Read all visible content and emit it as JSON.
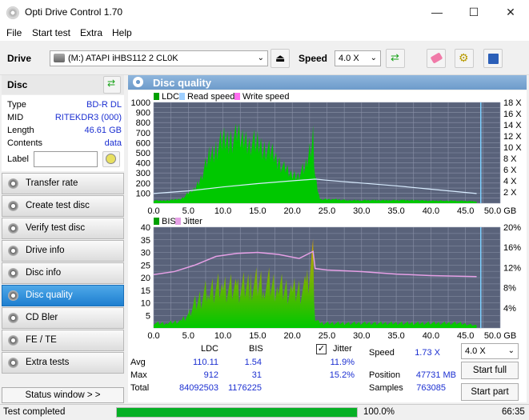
{
  "window": {
    "title": "Opti Drive Control 1.70",
    "minimize": "—",
    "maximize": "☐",
    "close": "✕"
  },
  "menu": [
    "File",
    "Start test",
    "Extra",
    "Help"
  ],
  "toolbar": {
    "drive_label": "Drive",
    "drive_value": "(M:)  ATAPI iHBS112  2 CL0K",
    "speed_label": "Speed",
    "speed_value": "4.0 X"
  },
  "disc": {
    "header": "Disc",
    "rows": [
      {
        "key": "Type",
        "value": "BD-R DL"
      },
      {
        "key": "MID",
        "value": "RITEKDR3 (000)"
      },
      {
        "key": "Length",
        "value": "46.61 GB"
      },
      {
        "key": "Contents",
        "value": "data"
      }
    ],
    "label_key": "Label",
    "label_value": ""
  },
  "nav": [
    {
      "label": "Transfer rate",
      "active": false
    },
    {
      "label": "Create test disc",
      "active": false
    },
    {
      "label": "Verify test disc",
      "active": false
    },
    {
      "label": "Drive info",
      "active": false
    },
    {
      "label": "Disc info",
      "active": false
    },
    {
      "label": "Disc quality",
      "active": true
    },
    {
      "label": "CD Bler",
      "active": false
    },
    {
      "label": "FE / TE",
      "active": false
    },
    {
      "label": "Extra tests",
      "active": false
    }
  ],
  "status_window_button": "Status window > >",
  "panel_title": "Disc quality",
  "chart_data": [
    {
      "type": "area",
      "legend": [
        "LDC",
        "Read speed",
        "Write speed"
      ],
      "colors": {
        "LDC": "#00c800",
        "Read speed": "#9ecfff",
        "Write speed": "#ff6ef0"
      },
      "x_ticks": [
        "0.0",
        "5.0",
        "10.0",
        "15.0",
        "20.0",
        "25.0",
        "30.0",
        "35.0",
        "40.0",
        "45.0",
        "50.0 GB"
      ],
      "y_ticks_left": [
        "100",
        "200",
        "300",
        "400",
        "500",
        "600",
        "700",
        "800",
        "900",
        "1000"
      ],
      "y_ticks_right": [
        "2 X",
        "4 X",
        "6 X",
        "8 X",
        "10 X",
        "12 X",
        "14 X",
        "16 X",
        "18 X"
      ],
      "xlim": [
        0,
        50
      ],
      "ylim": [
        0,
        1000
      ],
      "y2lim": [
        0,
        18
      ],
      "ldc_x": [
        0,
        1,
        2,
        3,
        4,
        5,
        6,
        7,
        8,
        9,
        10,
        11,
        12,
        13,
        14,
        15,
        16,
        17,
        18,
        19,
        20,
        21,
        22,
        23,
        23.3,
        24,
        26,
        28,
        30,
        32,
        34,
        36,
        38,
        40,
        42,
        44,
        46,
        46.6
      ],
      "ldc": [
        30,
        25,
        30,
        35,
        45,
        100,
        150,
        300,
        480,
        560,
        640,
        650,
        680,
        660,
        630,
        610,
        560,
        520,
        430,
        340,
        290,
        300,
        380,
        700,
        260,
        40,
        40,
        30,
        30,
        30,
        30,
        30,
        30,
        25,
        25,
        25,
        20,
        15
      ],
      "read_speed_x": [
        0,
        5,
        10,
        15,
        20,
        23.3,
        25,
        30,
        35,
        40,
        46.6
      ],
      "read_speed": [
        1.73,
        2.2,
        2.9,
        3.5,
        4.0,
        4.3,
        4.1,
        3.6,
        3.1,
        2.5,
        1.73
      ]
    },
    {
      "type": "area",
      "legend": [
        "BIS",
        "Jitter"
      ],
      "colors": {
        "BIS": "#00c800",
        "Jitter": "#e6a0e6"
      },
      "x_ticks": [
        "0.0",
        "5.0",
        "10.0",
        "15.0",
        "20.0",
        "25.0",
        "30.0",
        "35.0",
        "40.0",
        "45.0",
        "50.0 GB"
      ],
      "y_ticks_left": [
        "5",
        "10",
        "15",
        "20",
        "25",
        "30",
        "35",
        "40"
      ],
      "y_ticks_right": [
        "4%",
        "8%",
        "12%",
        "16%",
        "20%"
      ],
      "xlim": [
        0,
        50
      ],
      "ylim": [
        0,
        40
      ],
      "y2lim": [
        0,
        20
      ],
      "bis_x": [
        0,
        2,
        4,
        5,
        6,
        8,
        10,
        12,
        14,
        16,
        18,
        20,
        22,
        23,
        23.3,
        24,
        28,
        32,
        36,
        40,
        44,
        46.6
      ],
      "bis": [
        2,
        2,
        3,
        5,
        10,
        16,
        17,
        16,
        18,
        19,
        17,
        15,
        16,
        27,
        4,
        2,
        2,
        2,
        2,
        2,
        2,
        1
      ],
      "jitter_x": [
        0,
        3,
        6,
        9,
        12,
        15,
        18,
        21,
        23,
        23.3,
        25,
        30,
        35,
        40,
        46.6
      ],
      "jitter": [
        10.6,
        11.2,
        12.5,
        14.2,
        14.8,
        15.0,
        14.6,
        13.8,
        15.2,
        11.8,
        11.5,
        11.2,
        10.7,
        10.4,
        10.2
      ]
    }
  ],
  "stats": {
    "col_ldc": "LDC",
    "col_bis": "BIS",
    "jitter_label": "Jitter",
    "jitter_checked": true,
    "rows": [
      {
        "label": "Avg",
        "ldc": "110.11",
        "bis": "1.54",
        "jitter": "11.9%"
      },
      {
        "label": "Max",
        "ldc": "912",
        "bis": "31",
        "jitter": "15.2%"
      },
      {
        "label": "Total",
        "ldc": "84092503",
        "bis": "1176225",
        "jitter": ""
      }
    ],
    "speed_label": "Speed",
    "speed_value": "1.73 X",
    "position_label": "Position",
    "position_value": "47731 MB",
    "samples_label": "Samples",
    "samples_value": "763085",
    "speed_select": "4.0 X",
    "start_full": "Start full",
    "start_part": "Start part"
  },
  "status": {
    "text": "Test completed",
    "progress": 1.0,
    "progress_text": "100.0%",
    "time": "66:35"
  }
}
